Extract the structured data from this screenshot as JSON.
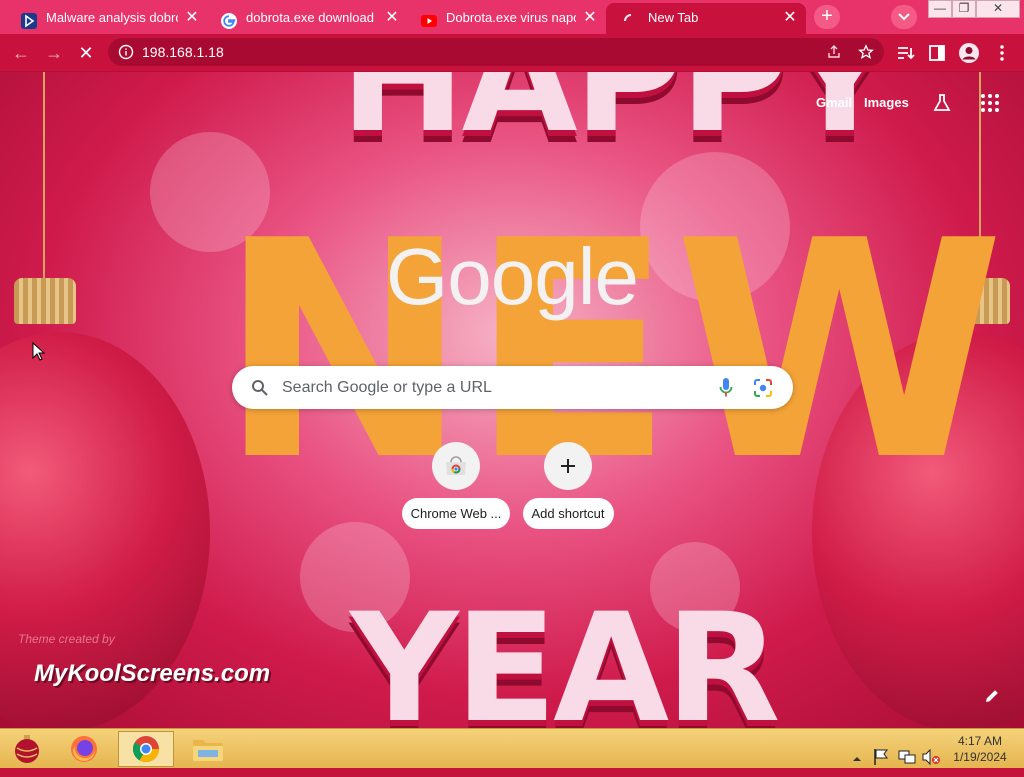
{
  "tabs": [
    {
      "title": "Malware analysis dobrota",
      "favicon": "anyrun-icon",
      "active": false
    },
    {
      "title": "dobrota.exe download - G",
      "favicon": "google-icon",
      "active": false
    },
    {
      "title": "Dobrota.exe virus napod",
      "favicon": "youtube-icon",
      "active": false
    },
    {
      "title": "New Tab",
      "favicon": "loading-icon",
      "active": true
    }
  ],
  "toolbar": {
    "url": "198.168.1.18"
  },
  "ntp": {
    "links": {
      "gmail": "Gmail",
      "images": "Images"
    },
    "logo": "Google",
    "search_placeholder": "Search Google or type a URL",
    "shortcuts": [
      {
        "label": "Chrome Web ...",
        "icon": "chrome-web-store-icon"
      },
      {
        "label": "Add shortcut",
        "icon": "plus-icon"
      }
    ],
    "theme": {
      "top_word": "HAPPY",
      "middle_word": "NEW",
      "bottom_word": "YEAR",
      "credit_small": "Theme created by",
      "credit_big": "MyKoolScreens.com"
    }
  },
  "taskbar": {
    "time": "4:17 AM",
    "date": "1/19/2024"
  },
  "colors": {
    "tabstrip": "#e8336a",
    "toolbar": "#c8113d",
    "omnibox": "#a90a31",
    "taskbar": "#f0c868"
  }
}
